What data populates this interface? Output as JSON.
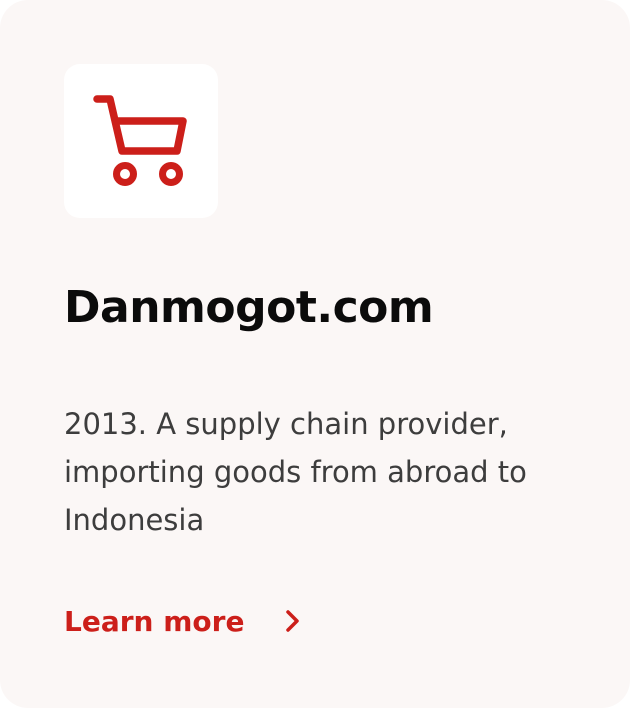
{
  "card": {
    "icon": "shopping-cart-icon",
    "title": "Danmogot.com",
    "description": "2013. A supply chain provider, importing goods from abroad to Indonesia",
    "link_label": "Learn more",
    "link_icon": "chevron-right-icon"
  },
  "colors": {
    "card_background": "#fbf7f6",
    "accent": "#cc1f1a",
    "title_text": "#0b0b0b",
    "body_text": "#3d3d3d"
  }
}
